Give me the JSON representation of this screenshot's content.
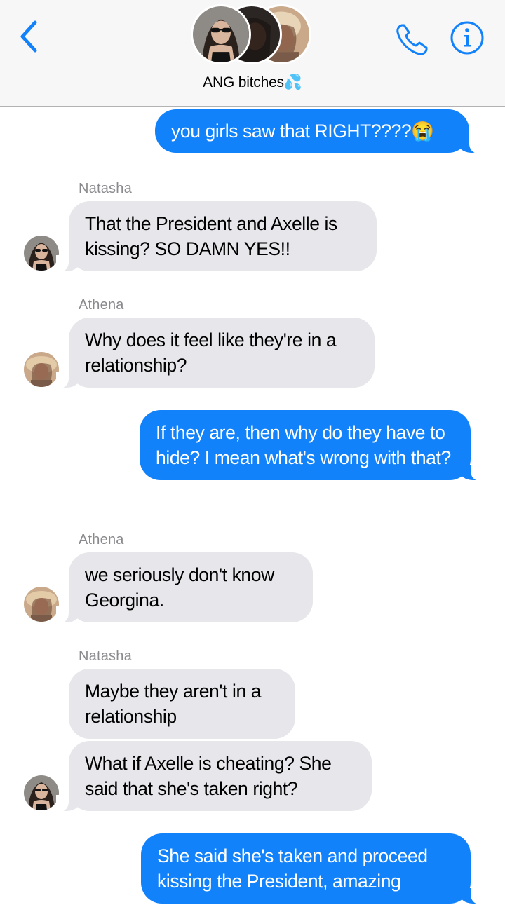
{
  "header": {
    "group_name": "ANG bitches💦",
    "back_icon": "chevron-left-icon",
    "call_icon": "phone-icon",
    "info_icon": "info-icon",
    "accent_color": "#1282fb"
  },
  "participants": [
    "Natasha",
    "Athena"
  ],
  "messages": [
    {
      "direction": "outgoing",
      "text": "you girls saw that RIGHT????😭"
    },
    {
      "direction": "incoming",
      "sender": "Natasha",
      "text": "That the President and Axelle is kissing? SO DAMN YES!!"
    },
    {
      "direction": "incoming",
      "sender": "Athena",
      "text": "Why does it feel like they're in a relationship?"
    },
    {
      "direction": "outgoing",
      "text": "If they are, then why do they have to hide? I mean what's wrong with that?"
    },
    {
      "direction": "incoming",
      "sender": "Athena",
      "text": "we seriously don't know Georgina."
    },
    {
      "direction": "incoming",
      "sender": "Natasha",
      "text": "Maybe they aren't in a relationship"
    },
    {
      "direction": "incoming",
      "text": "What if Axelle is cheating? She said that she's taken right?"
    },
    {
      "direction": "outgoing",
      "text": "She said she's taken and proceed kissing the President, amazing"
    }
  ]
}
